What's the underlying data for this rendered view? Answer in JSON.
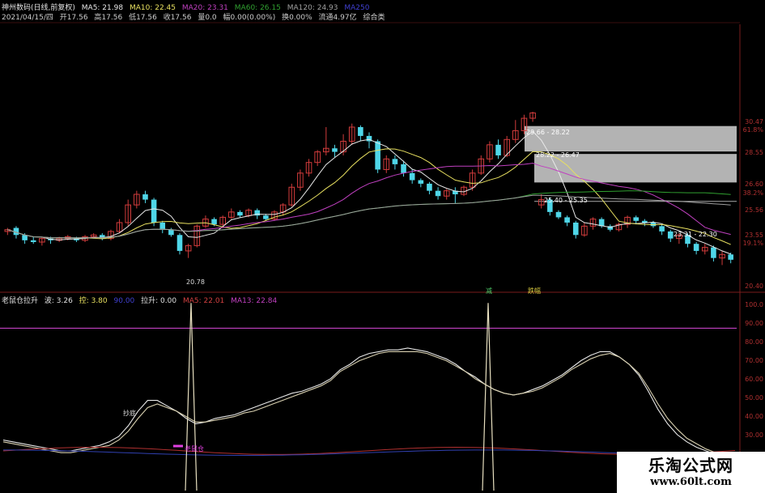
{
  "header": {
    "title": "神州数码(日线,前复权)",
    "ma5": "MA5: 21.98",
    "ma10": "MA10: 22.45",
    "ma20": "MA20: 23.31",
    "ma60": "MA60: 26.15",
    "ma120": "MA120: 24.93",
    "ma250": "MA250",
    "date": "2021/04/15/四",
    "open": "开17.56",
    "high": "高17.56",
    "low": "低17.56",
    "close": "收17.56",
    "volume": "量0.0",
    "change": "幅0.00(0.00%)",
    "turnover": "换0.00%",
    "float": "流通4.97亿",
    "composite": "综合类"
  },
  "indicator_header": {
    "name": "老鼠仓拉升",
    "v1": "波: 3.26",
    "v2": "控: 3.80",
    "v3": "90.00",
    "v4": "拉升: 0.00",
    "v5": "MA5: 22.01",
    "v6": "MA13: 22.84"
  },
  "annotations": {
    "low_price": "20.78",
    "box1_label": "29.66 - 28.22",
    "box2_label": "28.22 - 26.47",
    "box3_label": "25.40 - 25.35",
    "target_label": "23.31 - 22.30",
    "signal_a": "减",
    "signal_b": "跌幅",
    "upper_label": "抄底",
    "lower_label": "老鼠仓"
  },
  "price_axis": [
    "30.47",
    "61.8%",
    "28.55",
    "26.60",
    "38.2%",
    "25.56",
    "23.55",
    "19.1%",
    "20.40"
  ],
  "indicator_axis": [
    "100.0",
    "90.00",
    "80.00",
    "70.00",
    "60.00",
    "50.00",
    "40.00",
    "30.00",
    "20.00"
  ],
  "colors": {
    "up": "#d23c3c",
    "down": "#4fd6e8",
    "ma5": "#e8e8e8",
    "ma10": "#e8e060",
    "ma20": "#c040c0",
    "ma60": "#30a030",
    "ma120": "#a0a0a0"
  },
  "watermark": {
    "line1": "乐淘公式网",
    "line2": "www.60lt.com"
  },
  "chart_data": [
    {
      "type": "candlestick",
      "title": "神州数码(日线,前复权)",
      "ylim": [
        20.4,
        30.47
      ],
      "candles": [
        {
          "o": 23.7,
          "c": 23.8,
          "h": 23.9,
          "l": 23.5
        },
        {
          "o": 23.9,
          "c": 23.5,
          "h": 24.0,
          "l": 23.3
        },
        {
          "o": 23.5,
          "c": 23.2,
          "h": 23.6,
          "l": 23.0
        },
        {
          "o": 23.2,
          "c": 23.1,
          "h": 23.4,
          "l": 23.0
        },
        {
          "o": 23.1,
          "c": 23.3,
          "h": 23.4,
          "l": 22.9
        },
        {
          "o": 23.3,
          "c": 23.2,
          "h": 23.4,
          "l": 23.0
        },
        {
          "o": 23.2,
          "c": 23.3,
          "h": 23.4,
          "l": 23.1
        },
        {
          "o": 23.3,
          "c": 23.4,
          "h": 23.5,
          "l": 23.2
        },
        {
          "o": 23.3,
          "c": 23.2,
          "h": 23.4,
          "l": 23.1
        },
        {
          "o": 23.2,
          "c": 23.4,
          "h": 23.5,
          "l": 23.1
        },
        {
          "o": 23.4,
          "c": 23.5,
          "h": 23.6,
          "l": 23.3
        },
        {
          "o": 23.5,
          "c": 23.3,
          "h": 23.6,
          "l": 23.2
        },
        {
          "o": 23.3,
          "c": 23.7,
          "h": 23.8,
          "l": 23.2
        },
        {
          "o": 23.7,
          "c": 24.2,
          "h": 24.4,
          "l": 23.6
        },
        {
          "o": 24.2,
          "c": 25.2,
          "h": 25.5,
          "l": 24.0
        },
        {
          "o": 25.2,
          "c": 25.8,
          "h": 26.0,
          "l": 25.0
        },
        {
          "o": 25.8,
          "c": 25.5,
          "h": 26.0,
          "l": 25.3
        },
        {
          "o": 25.5,
          "c": 24.2,
          "h": 25.6,
          "l": 24.0
        },
        {
          "o": 24.2,
          "c": 23.8,
          "h": 24.3,
          "l": 23.6
        },
        {
          "o": 23.8,
          "c": 23.5,
          "h": 23.9,
          "l": 23.4
        },
        {
          "o": 23.5,
          "c": 22.6,
          "h": 23.6,
          "l": 22.4
        },
        {
          "o": 22.6,
          "c": 22.9,
          "h": 23.0,
          "l": 22.2
        },
        {
          "o": 22.9,
          "c": 24.0,
          "h": 24.1,
          "l": 22.8
        },
        {
          "o": 24.0,
          "c": 24.4,
          "h": 24.6,
          "l": 23.9
        },
        {
          "o": 24.4,
          "c": 24.1,
          "h": 24.5,
          "l": 24.0
        },
        {
          "o": 24.1,
          "c": 24.5,
          "h": 24.6,
          "l": 23.9
        },
        {
          "o": 24.5,
          "c": 24.8,
          "h": 25.0,
          "l": 24.4
        },
        {
          "o": 24.8,
          "c": 24.6,
          "h": 24.9,
          "l": 24.5
        },
        {
          "o": 24.6,
          "c": 24.9,
          "h": 25.0,
          "l": 24.5
        },
        {
          "o": 24.9,
          "c": 24.6,
          "h": 25.0,
          "l": 24.4
        },
        {
          "o": 24.6,
          "c": 24.4,
          "h": 24.7,
          "l": 24.3
        },
        {
          "o": 24.4,
          "c": 24.8,
          "h": 24.9,
          "l": 24.3
        },
        {
          "o": 24.8,
          "c": 25.2,
          "h": 25.3,
          "l": 24.6
        },
        {
          "o": 25.2,
          "c": 26.2,
          "h": 26.4,
          "l": 25.1
        },
        {
          "o": 26.2,
          "c": 27.0,
          "h": 27.2,
          "l": 26.0
        },
        {
          "o": 27.0,
          "c": 27.6,
          "h": 27.8,
          "l": 26.8
        },
        {
          "o": 27.6,
          "c": 28.2,
          "h": 28.3,
          "l": 27.4
        },
        {
          "o": 28.2,
          "c": 28.4,
          "h": 29.6,
          "l": 28.0
        },
        {
          "o": 28.4,
          "c": 28.2,
          "h": 28.6,
          "l": 27.9
        },
        {
          "o": 28.2,
          "c": 28.8,
          "h": 29.2,
          "l": 28.0
        },
        {
          "o": 28.8,
          "c": 29.6,
          "h": 29.8,
          "l": 28.6
        },
        {
          "o": 29.6,
          "c": 29.1,
          "h": 29.7,
          "l": 28.8
        },
        {
          "o": 29.1,
          "c": 28.8,
          "h": 29.3,
          "l": 28.4
        },
        {
          "o": 28.8,
          "c": 27.2,
          "h": 28.9,
          "l": 27.0
        },
        {
          "o": 27.2,
          "c": 27.8,
          "h": 28.0,
          "l": 27.0
        },
        {
          "o": 27.8,
          "c": 27.5,
          "h": 28.0,
          "l": 27.2
        },
        {
          "o": 27.5,
          "c": 27.0,
          "h": 27.7,
          "l": 26.8
        },
        {
          "o": 27.0,
          "c": 26.6,
          "h": 27.2,
          "l": 26.4
        },
        {
          "o": 26.6,
          "c": 26.4,
          "h": 26.7,
          "l": 26.2
        },
        {
          "o": 26.4,
          "c": 26.0,
          "h": 26.5,
          "l": 25.8
        },
        {
          "o": 26.0,
          "c": 25.7,
          "h": 26.2,
          "l": 25.5
        },
        {
          "o": 25.7,
          "c": 26.0,
          "h": 26.1,
          "l": 25.5
        },
        {
          "o": 26.0,
          "c": 25.8,
          "h": 26.2,
          "l": 25.3
        },
        {
          "o": 25.8,
          "c": 26.2,
          "h": 26.3,
          "l": 25.7
        },
        {
          "o": 26.2,
          "c": 27.0,
          "h": 27.2,
          "l": 26.0
        },
        {
          "o": 27.0,
          "c": 27.8,
          "h": 28.0,
          "l": 26.9
        },
        {
          "o": 27.8,
          "c": 28.6,
          "h": 28.8,
          "l": 27.6
        },
        {
          "o": 28.6,
          "c": 28.0,
          "h": 28.9,
          "l": 27.8
        },
        {
          "o": 28.0,
          "c": 28.9,
          "h": 29.1,
          "l": 27.9
        },
        {
          "o": 28.9,
          "c": 29.4,
          "h": 30.0,
          "l": 28.7
        },
        {
          "o": 29.4,
          "c": 30.1,
          "h": 30.3,
          "l": 29.2
        },
        {
          "o": 30.1,
          "c": 30.4,
          "h": 30.47,
          "l": 29.9
        },
        {
          "o": 25.2,
          "c": 25.5,
          "h": 25.8,
          "l": 25.0
        },
        {
          "o": 25.5,
          "c": 24.8,
          "h": 25.6,
          "l": 24.6
        },
        {
          "o": 24.8,
          "c": 24.5,
          "h": 24.9,
          "l": 24.4
        },
        {
          "o": 24.5,
          "c": 24.2,
          "h": 24.6,
          "l": 24.0
        },
        {
          "o": 24.2,
          "c": 23.5,
          "h": 24.3,
          "l": 23.3
        },
        {
          "o": 23.5,
          "c": 24.0,
          "h": 24.2,
          "l": 23.4
        },
        {
          "o": 24.0,
          "c": 24.4,
          "h": 24.5,
          "l": 23.8
        },
        {
          "o": 24.4,
          "c": 24.0,
          "h": 24.5,
          "l": 23.9
        },
        {
          "o": 24.0,
          "c": 23.8,
          "h": 24.1,
          "l": 23.7
        },
        {
          "o": 23.8,
          "c": 24.1,
          "h": 24.2,
          "l": 23.7
        },
        {
          "o": 24.1,
          "c": 24.5,
          "h": 24.6,
          "l": 23.9
        },
        {
          "o": 24.5,
          "c": 24.3,
          "h": 24.6,
          "l": 24.1
        },
        {
          "o": 24.3,
          "c": 24.2,
          "h": 24.4,
          "l": 24.0
        },
        {
          "o": 24.2,
          "c": 24.0,
          "h": 24.3,
          "l": 23.9
        },
        {
          "o": 24.0,
          "c": 23.7,
          "h": 24.1,
          "l": 23.5
        },
        {
          "o": 23.7,
          "c": 23.3,
          "h": 23.8,
          "l": 23.1
        },
        {
          "o": 23.3,
          "c": 23.5,
          "h": 23.6,
          "l": 23.0
        },
        {
          "o": 23.5,
          "c": 23.0,
          "h": 23.6,
          "l": 22.8
        },
        {
          "o": 23.0,
          "c": 22.6,
          "h": 23.1,
          "l": 22.4
        },
        {
          "o": 22.6,
          "c": 22.8,
          "h": 23.0,
          "l": 22.4
        },
        {
          "o": 22.8,
          "c": 22.2,
          "h": 22.9,
          "l": 22.0
        },
        {
          "o": 22.2,
          "c": 22.4,
          "h": 22.6,
          "l": 21.8
        },
        {
          "o": 22.4,
          "c": 22.1,
          "h": 22.5,
          "l": 21.9
        }
      ],
      "levels": [
        29.66,
        28.22,
        26.47,
        25.4
      ]
    },
    {
      "type": "line",
      "title": "老鼠仓拉升",
      "ylim": [
        0,
        105
      ],
      "series": [
        {
          "name": "波",
          "values": [
            28,
            27,
            26,
            25,
            24,
            23,
            22,
            22,
            23,
            24,
            25,
            27,
            30,
            36,
            44,
            50,
            50,
            47,
            44,
            40,
            37,
            38,
            40,
            41,
            42,
            44,
            46,
            48,
            50,
            52,
            54,
            55,
            57,
            59,
            62,
            67,
            70,
            74,
            76,
            77,
            78,
            78,
            79,
            78,
            77,
            75,
            73,
            70,
            66,
            63,
            59,
            56,
            54,
            53,
            54,
            56,
            58,
            61,
            64,
            68,
            72,
            75,
            77,
            77,
            74,
            70,
            64,
            55,
            45,
            37,
            31,
            27,
            24,
            22,
            20,
            19,
            18
          ]
        },
        {
          "name": "控",
          "values": [
            27,
            26,
            25,
            24,
            23,
            22,
            21,
            21,
            22,
            23,
            24,
            25,
            28,
            33,
            40,
            46,
            48,
            46,
            44,
            41,
            38,
            38,
            39,
            40,
            41,
            43,
            44,
            46,
            48,
            50,
            52,
            54,
            56,
            58,
            61,
            66,
            69,
            72,
            74,
            76,
            77,
            77,
            77,
            77,
            76,
            74,
            72,
            69,
            66,
            62,
            59,
            56,
            54,
            53,
            54,
            55,
            57,
            60,
            63,
            67,
            70,
            73,
            75,
            76,
            74,
            70,
            65,
            57,
            48,
            40,
            34,
            29,
            26,
            23,
            21,
            20,
            19
          ]
        }
      ]
    }
  ]
}
